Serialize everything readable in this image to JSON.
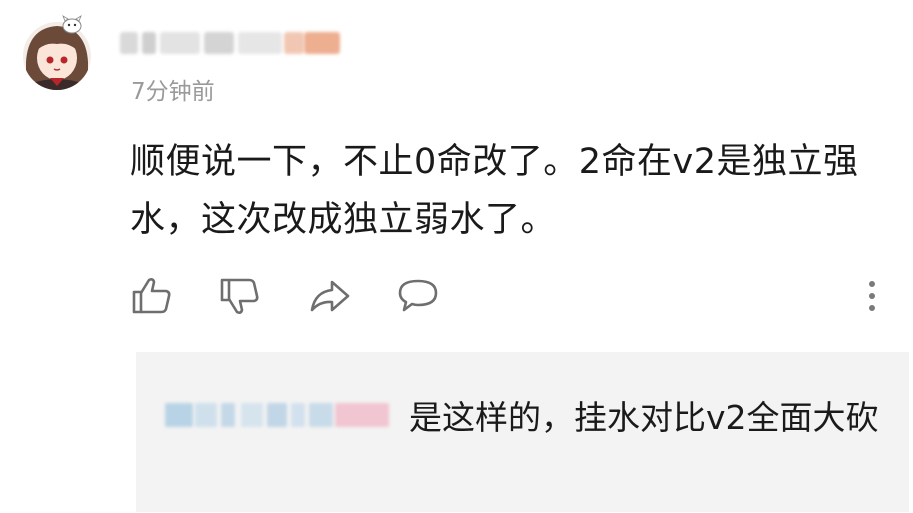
{
  "comment": {
    "timestamp": "7分钟前",
    "text": "顺便说一下，不止0命改了。2命在v2是独立强水，这次改成独立弱水了。"
  },
  "actions": {
    "like_icon": "thumbs-up-icon",
    "dislike_icon": "thumbs-down-icon",
    "share_icon": "share-icon",
    "reply_icon": "comment-bubble-icon",
    "more_icon": "more-vertical-icon"
  },
  "reply": {
    "text": "是这样的，挂水对比v2全面大砍"
  },
  "colors": {
    "text_primary": "#1a1a1a",
    "text_secondary": "#9a9a9a",
    "icon": "#6e6e6e",
    "reply_background": "#f3f3f3"
  }
}
